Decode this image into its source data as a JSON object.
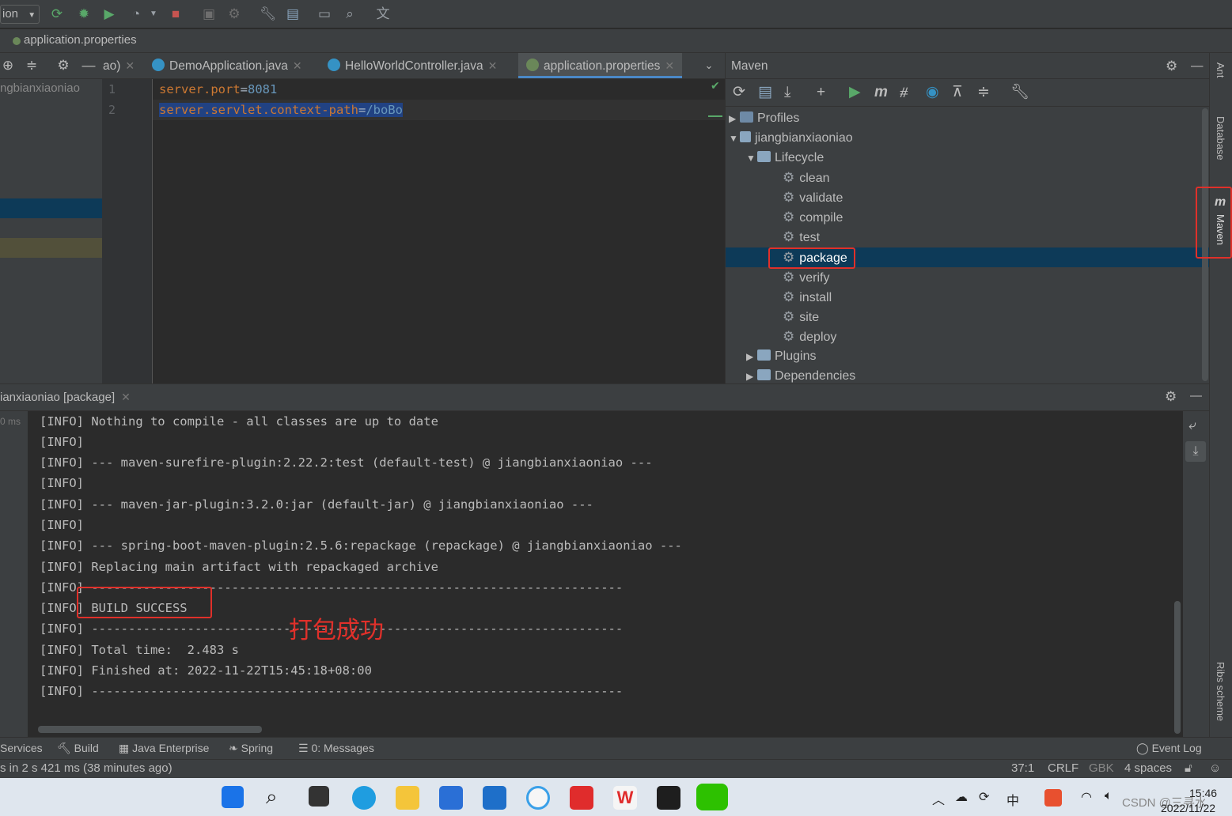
{
  "toolbar": {
    "run_config": "ion"
  },
  "breadcrumb": "application.properties",
  "project_panel": {
    "item_label": "ngbianxiaoniao"
  },
  "editor_tabs": [
    {
      "label": "ao)"
    },
    {
      "label": "DemoApplication.java"
    },
    {
      "label": "HelloWorldController.java"
    },
    {
      "label": "application.properties"
    }
  ],
  "editor": {
    "lines": [
      {
        "num": "1",
        "key": "server.port",
        "eq": "=",
        "value": "8081"
      },
      {
        "num": "2",
        "key": "server.servlet.context-path",
        "eq": "=",
        "value": "/boBo"
      }
    ]
  },
  "maven": {
    "title": "Maven",
    "profiles": "Profiles",
    "project": "jiangbianxiaoniao",
    "lifecycle": "Lifecycle",
    "goals": [
      "clean",
      "validate",
      "compile",
      "test",
      "package",
      "verify",
      "install",
      "site",
      "deploy"
    ],
    "selected_goal": "package",
    "plugins": "Plugins",
    "dependencies": "Dependencies"
  },
  "right_strip": {
    "ant": "Ant",
    "database": "Database",
    "maven": "Maven",
    "ribs": "Ribs scheme"
  },
  "run": {
    "tab_label": "ianxiaoniao [package]",
    "time_label": "0 ms",
    "console": [
      "[INFO] Nothing to compile - all classes are up to date",
      "[INFO]",
      "[INFO] --- maven-surefire-plugin:2.22.2:test (default-test) @ jiangbianxiaoniao ---",
      "[INFO]",
      "[INFO] --- maven-jar-plugin:3.2.0:jar (default-jar) @ jiangbianxiaoniao ---",
      "[INFO]",
      "[INFO] --- spring-boot-maven-plugin:2.5.6:repackage (repackage) @ jiangbianxiaoniao ---",
      "[INFO] Replacing main artifact with repackaged archive",
      "[INFO] ------------------------------------------------------------------------",
      "[INFO] BUILD SUCCESS",
      "[INFO] ------------------------------------------------------------------------",
      "[INFO] Total time:  2.483 s",
      "[INFO] Finished at: 2022-11-22T15:45:18+08:00",
      "[INFO] ------------------------------------------------------------------------"
    ],
    "annotation": "打包成功"
  },
  "bottom_tabs": {
    "services": "Services",
    "build": "Build",
    "java_enterprise": "Java Enterprise",
    "spring": "Spring",
    "messages": "0: Messages",
    "event_log": "Event Log"
  },
  "status_bar": {
    "left": "s in 2 s 421 ms (38 minutes ago)",
    "position": "37:1",
    "line_sep": "CRLF",
    "encoding": "GBK",
    "indent": "4 spaces"
  },
  "taskbar": {
    "ime": "中",
    "time": "15:46",
    "date": "2022/11/22",
    "watermark": "CSDN @三寻水"
  },
  "colors": {
    "highlight": "#e0302a",
    "selection": "#0d3a58",
    "accent": "#4a88c7"
  }
}
